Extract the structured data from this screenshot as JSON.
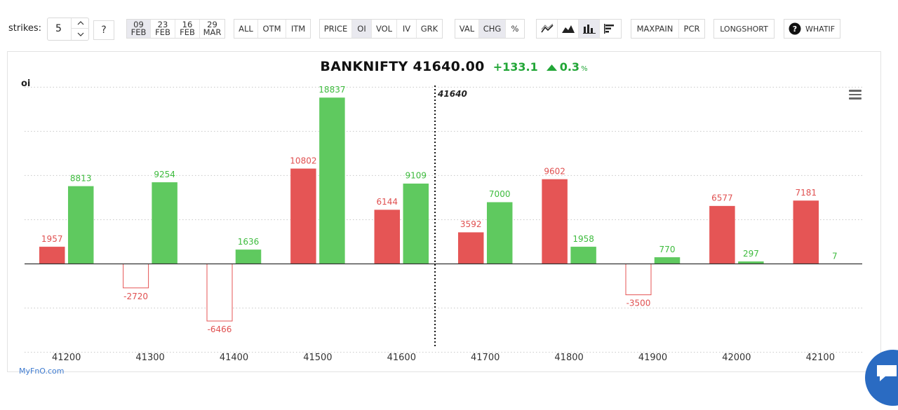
{
  "toolbar": {
    "strikes_label": "strikes:",
    "strikes_value": "5",
    "help_label": "?",
    "expiries": [
      {
        "top": "09",
        "bottom": "FEB",
        "active": true
      },
      {
        "top": "23",
        "bottom": "FEB",
        "active": false
      },
      {
        "top": "16",
        "bottom": "FEB",
        "active": false
      },
      {
        "top": "29",
        "bottom": "MAR",
        "active": false
      }
    ],
    "filter": [
      "ALL",
      "OTM",
      "ITM"
    ],
    "metric": [
      "PRICE",
      "OI",
      "VOL",
      "IV",
      "GRK"
    ],
    "metric_active": "OI",
    "mode": [
      "VAL",
      "CHG",
      "%"
    ],
    "mode_active": "CHG",
    "chart_icons": [
      "line-chart-icon",
      "area-chart-icon",
      "bar-chart-icon",
      "horizontal-bar-icon"
    ],
    "maxpain_label": "MAXPAIN",
    "pcr_label": "PCR",
    "longshort_label": "LONGSHORT",
    "whatif_label": "WHATIF"
  },
  "header": {
    "symbol": "BANKNIFTY",
    "price": "41640.00",
    "change": "+133.1",
    "pct_change": "0.3",
    "pct_symbol": "%"
  },
  "colors": {
    "call": "#e55555",
    "put": "#5fc95f",
    "call_label": "#e05050",
    "put_label": "#3dbb3d",
    "accent_blue": "#2a6bc2"
  },
  "watermark": "MyFnO.com",
  "chart_data": {
    "type": "bar",
    "ylabel": "oi",
    "spot_label": "41640",
    "spot": 41640,
    "categories": [
      "41200",
      "41300",
      "41400",
      "41500",
      "41600",
      "41700",
      "41800",
      "41900",
      "42000",
      "42100"
    ],
    "series": [
      {
        "values": [
          1957,
          -2720,
          -6466,
          10802,
          6144,
          3592,
          9602,
          -3500,
          6577,
          7181
        ]
      },
      {
        "values": [
          8813,
          9254,
          1636,
          18837,
          9109,
          7000,
          1958,
          770,
          297,
          7
        ]
      }
    ],
    "ylim": [
      -10000,
      20000
    ],
    "grid": true
  }
}
